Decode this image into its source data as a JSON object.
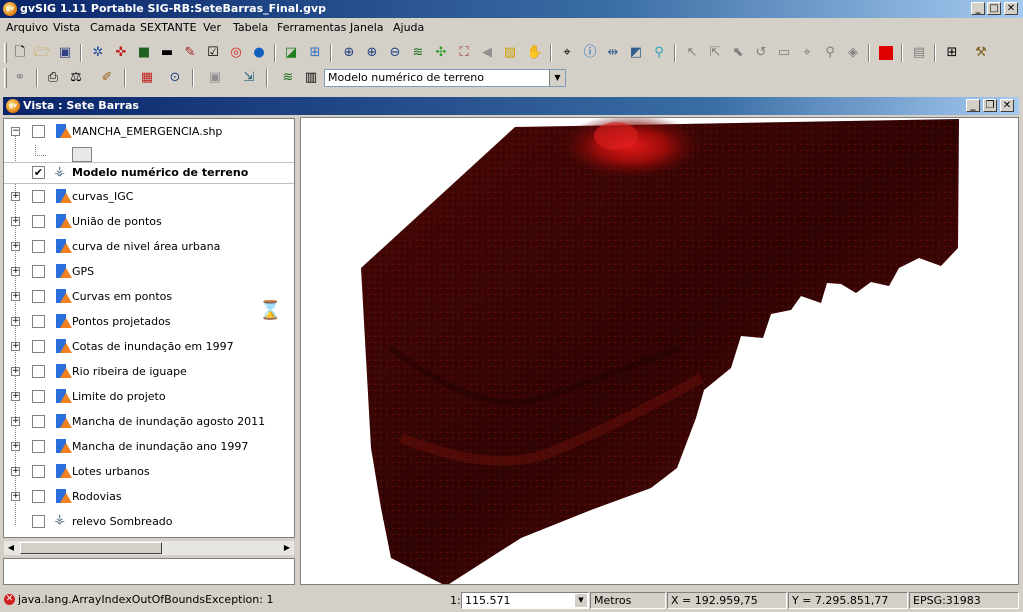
{
  "window": {
    "title": "gvSIG 1.11 Portable SIG-RB:SeteBarras_Final.gvp"
  },
  "menu": [
    "Arquivo",
    "Vista",
    "Camada",
    "SEXTANTE",
    "Ver",
    "Tabela",
    "Ferramentas",
    "Janela",
    "Ajuda"
  ],
  "toolbar": {
    "layer_combo_value": "Modelo numérico de terreno"
  },
  "view": {
    "title": "Vista : Sete Barras"
  },
  "toc": {
    "layers": [
      {
        "name": "MANCHA_EMERGENCIA.shp",
        "checked": false,
        "type": "vector",
        "expanded": true
      },
      {
        "name": "Modelo numérico de terreno",
        "checked": true,
        "type": "raster",
        "selected": true
      },
      {
        "name": "curvas_IGC",
        "checked": false,
        "type": "vector"
      },
      {
        "name": "União de pontos",
        "checked": false,
        "type": "vector"
      },
      {
        "name": "curva de nivel área urbana",
        "checked": false,
        "type": "vector"
      },
      {
        "name": "GPS",
        "checked": false,
        "type": "vector"
      },
      {
        "name": "Curvas em pontos",
        "checked": false,
        "type": "vector"
      },
      {
        "name": "Pontos projetados",
        "checked": false,
        "type": "vector"
      },
      {
        "name": "Cotas de inundação em 1997",
        "checked": false,
        "type": "vector"
      },
      {
        "name": "Rio ribeira de iguape",
        "checked": false,
        "type": "vector"
      },
      {
        "name": "Limite do projeto",
        "checked": false,
        "type": "vector"
      },
      {
        "name": "Mancha de inundação agosto 2011",
        "checked": false,
        "type": "vector"
      },
      {
        "name": "Mancha  de inundação ano 1997",
        "checked": false,
        "type": "vector"
      },
      {
        "name": "Lotes urbanos",
        "checked": false,
        "type": "vector"
      },
      {
        "name": "Rodovias",
        "checked": false,
        "type": "vector"
      },
      {
        "name": "relevo Sombreado",
        "checked": false,
        "type": "raster"
      }
    ]
  },
  "status": {
    "error": "java.lang.ArrayIndexOutOfBoundsException: 1",
    "scale_prefix": "1:",
    "scale": "115.571",
    "units": "Metros",
    "x": "X = 192.959,75",
    "y": "Y = 7.295.851,77",
    "crs": "EPSG:31983"
  },
  "colors": {
    "title_bar": "#0a246a",
    "raster_dark": "#3a0503",
    "raster_bright": "#c01010"
  }
}
